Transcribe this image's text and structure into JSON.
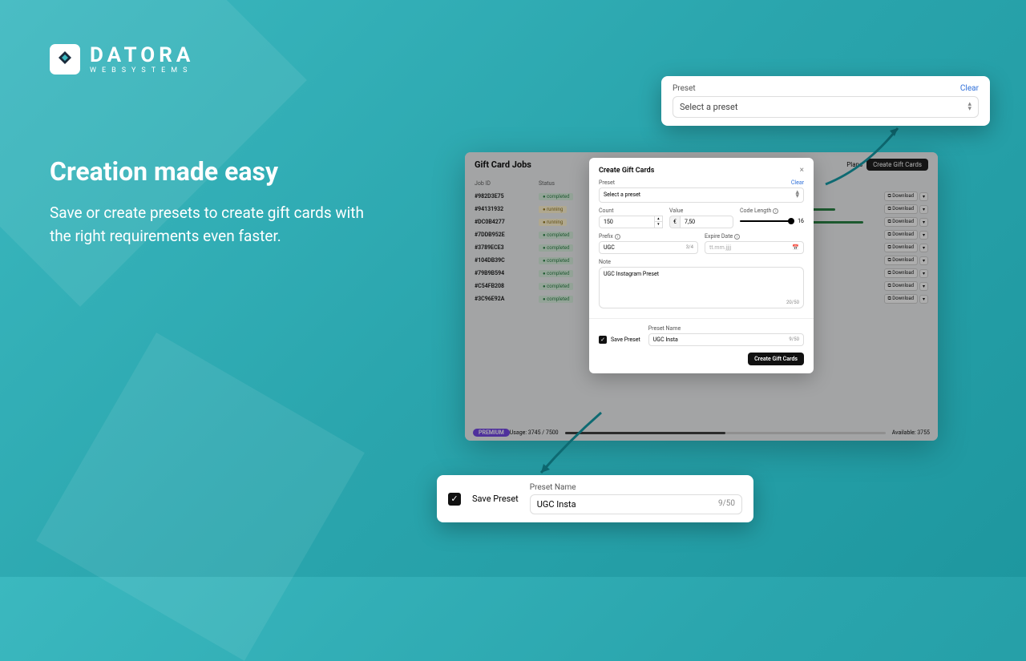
{
  "brand": {
    "name": "DATORA",
    "sub": "WEBSYSTEMS"
  },
  "hero": {
    "title": "Creation made easy",
    "body": "Save or create presets to create gift cards with the right requirements even faster."
  },
  "app": {
    "title": "Gift Card Jobs",
    "plans": "Plans",
    "create_btn": "Create Gift Cards",
    "columns": {
      "job_id": "Job ID",
      "status": "Status"
    },
    "download": "Download",
    "rows": [
      {
        "id": "#982D3E75",
        "status": "completed"
      },
      {
        "id": "#94131932",
        "status": "running"
      },
      {
        "id": "#DC0B4277",
        "status": "running"
      },
      {
        "id": "#7DDB952E",
        "status": "completed"
      },
      {
        "id": "#3789ECE3",
        "status": "completed"
      },
      {
        "id": "#104DB39C",
        "status": "completed"
      },
      {
        "id": "#79B9B594",
        "status": "completed"
      },
      {
        "id": "#C54FB208",
        "status": "completed"
      },
      {
        "id": "#3C96E92A",
        "status": "completed"
      }
    ],
    "premium": "PREMIUM",
    "usage": "Usage: 3745 / 7500",
    "available": "Available: 3755"
  },
  "modal": {
    "title": "Create Gift Cards",
    "preset_label": "Preset",
    "clear": "Clear",
    "preset_placeholder": "Select a preset",
    "count_label": "Count",
    "count_value": "150",
    "value_label": "Value",
    "currency": "€",
    "value_value": "7,50",
    "code_len_label": "Code Length",
    "code_len_value": "16",
    "prefix_label": "Prefix",
    "prefix_value": "UGC",
    "prefix_counter": "3/4",
    "expire_label": "Expire Date",
    "expire_placeholder": "tt.mm.jjjj",
    "note_label": "Note",
    "note_value": "UGC Instagram Preset",
    "note_counter": "20/50",
    "save_preset": "Save Preset",
    "preset_name_label": "Preset Name",
    "preset_name_value": "UGC Insta",
    "preset_name_counter": "9/50",
    "submit": "Create Gift Cards"
  },
  "callout_top": {
    "label": "Preset",
    "clear": "Clear",
    "placeholder": "Select a preset"
  },
  "callout_bot": {
    "save": "Save Preset",
    "name_label": "Preset Name",
    "name_value": "UGC Insta",
    "name_counter": "9/50"
  }
}
